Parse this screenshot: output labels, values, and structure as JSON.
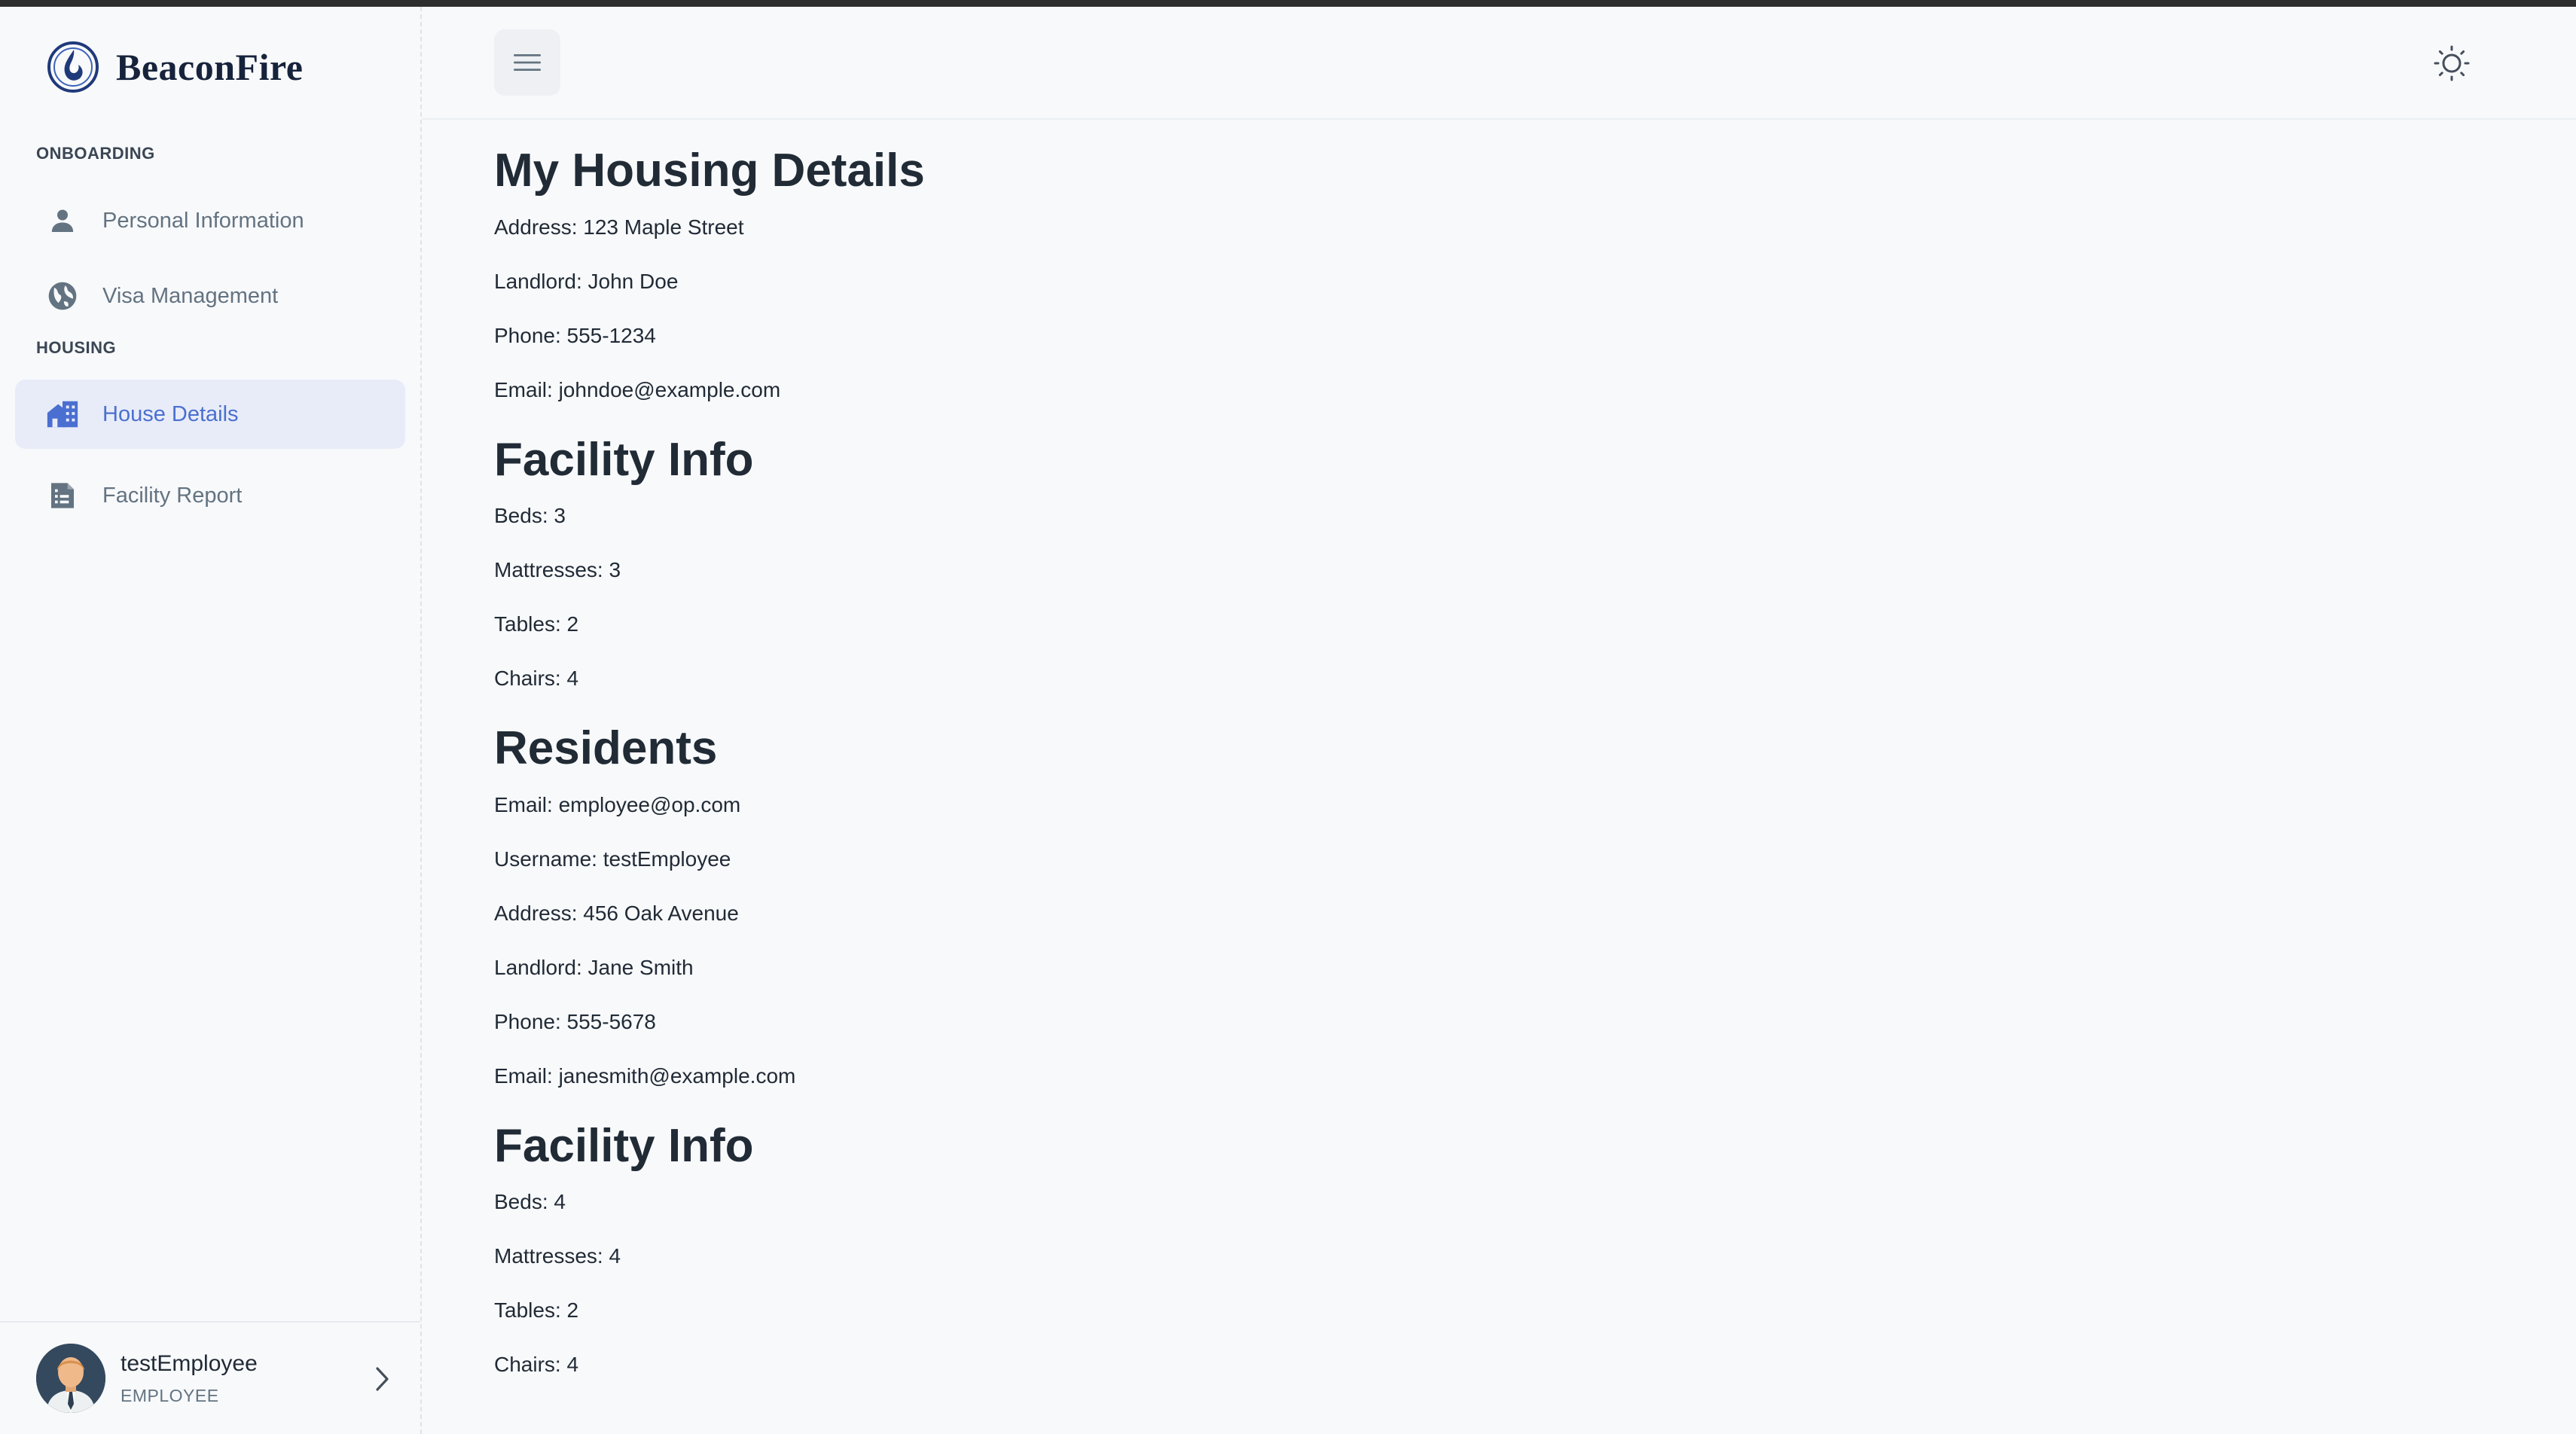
{
  "app": {
    "brand": "BeaconFire"
  },
  "sidebar": {
    "sections": [
      {
        "label": "ONBOARDING"
      },
      {
        "label": "HOUSING"
      }
    ],
    "items": [
      {
        "label": "Personal Information",
        "icon": "person-icon",
        "active": false
      },
      {
        "label": "Visa Management",
        "icon": "globe-icon",
        "active": false
      },
      {
        "label": "House Details",
        "icon": "house-icon",
        "active": true
      },
      {
        "label": "Facility Report",
        "icon": "report-icon",
        "active": false
      }
    ],
    "user": {
      "name": "testEmployee",
      "role": "EMPLOYEE"
    }
  },
  "header": {
    "menu_icon": "hamburger-icon",
    "theme_icon": "sun-icon"
  },
  "main": {
    "housing_title": "My Housing Details",
    "housing": {
      "address": "Address: 123 Maple Street",
      "landlord": "Landlord: John Doe",
      "phone": "Phone: 555-1234",
      "email": "Email: johndoe@example.com"
    },
    "facility1_title": "Facility Info",
    "facility1": {
      "beds": "Beds: 3",
      "mattresses": "Mattresses: 3",
      "tables": "Tables: 2",
      "chairs": "Chairs: 4"
    },
    "residents_title": "Residents",
    "resident": {
      "email": "Email: employee@op.com",
      "username": "Username: testEmployee",
      "address": "Address: 456 Oak Avenue",
      "landlord": "Landlord: Jane Smith",
      "phone": "Phone: 555-5678",
      "landlord_email": "Email: janesmith@example.com"
    },
    "facility2_title": "Facility Info",
    "facility2": {
      "beds": "Beds: 4",
      "mattresses": "Mattresses: 4",
      "tables": "Tables: 2",
      "chairs": "Chairs: 4"
    }
  },
  "colors": {
    "accent": "#4a6fd1",
    "active_bg": "#e8ecf8",
    "text": "#212b36",
    "muted": "#637381"
  }
}
